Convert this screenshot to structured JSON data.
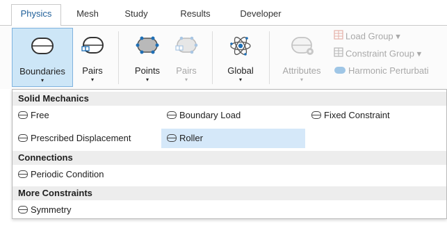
{
  "tabs": [
    {
      "label": "Physics",
      "active": true
    },
    {
      "label": "Mesh"
    },
    {
      "label": "Study"
    },
    {
      "label": "Results"
    },
    {
      "label": "Developer"
    }
  ],
  "ribbon": {
    "boundaries": {
      "label": "Boundaries",
      "icon": "boundary-icon",
      "arrow": "▾"
    },
    "pairs": {
      "label": "Pairs",
      "icon": "pairs-icon",
      "arrow": "▾"
    },
    "points": {
      "label": "Points",
      "icon": "points-icon",
      "arrow": "▾"
    },
    "pairs_disabled": {
      "label": "Pairs",
      "icon": "point-pairs-icon",
      "arrow": "▾"
    },
    "global": {
      "label": "Global",
      "icon": "atom-icon",
      "arrow": "▾"
    },
    "attributes": {
      "label": "Attributes",
      "icon": "attributes-icon",
      "arrow": "▾"
    },
    "load_group": {
      "label": "Load Group ▾",
      "icon": "load-group-icon"
    },
    "constraint_group": {
      "label": "Constraint Group ▾",
      "icon": "constraint-group-icon"
    },
    "harmonic_perturbation": {
      "label": "Harmonic Perturbati",
      "icon": "harmonic-perturbation-icon"
    }
  },
  "menu": {
    "sections": [
      {
        "header": "Solid Mechanics"
      },
      {
        "header": "Connections"
      },
      {
        "header": "More Constraints"
      }
    ],
    "items": {
      "free": "Free",
      "boundary_load": "Boundary Load",
      "fixed_constraint": "Fixed Constraint",
      "prescribed_displacement": "Prescribed Displacement",
      "roller": "Roller",
      "periodic_condition": "Periodic Condition",
      "symmetry": "Symmetry"
    },
    "highlighted": "roller"
  },
  "colors": {
    "accent": "#1f5f99",
    "selected_bg": "#cde6f7",
    "highlight_bg": "#d5e8f9",
    "section_bg": "#ededed"
  }
}
